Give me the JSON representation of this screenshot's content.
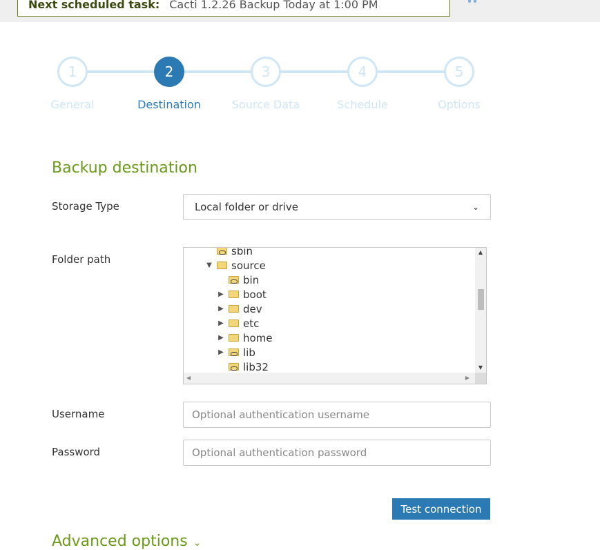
{
  "header": {
    "scheduled_label": "Next scheduled task:",
    "scheduled_value": "Cacti 1.2.26 Backup Today at 1:00 PM"
  },
  "steps": [
    {
      "num": "1",
      "label": "General"
    },
    {
      "num": "2",
      "label": "Destination"
    },
    {
      "num": "3",
      "label": "Source Data"
    },
    {
      "num": "4",
      "label": "Schedule"
    },
    {
      "num": "5",
      "label": "Options"
    }
  ],
  "active_step": 2,
  "section": {
    "title": "Backup destination"
  },
  "storage": {
    "label": "Storage Type",
    "value": "Local folder or drive"
  },
  "folder": {
    "label": "Folder path",
    "tree": [
      {
        "name": "sbin",
        "icon": "folder-link-icon",
        "toggle": "",
        "depth": 1
      },
      {
        "name": "source",
        "icon": "folder-icon",
        "toggle": "▼",
        "depth": 1
      },
      {
        "name": "bin",
        "icon": "folder-link-icon",
        "toggle": "",
        "depth": 2
      },
      {
        "name": "boot",
        "icon": "folder-icon",
        "toggle": "▶",
        "depth": 2
      },
      {
        "name": "dev",
        "icon": "folder-icon",
        "toggle": "▶",
        "depth": 2
      },
      {
        "name": "etc",
        "icon": "folder-icon",
        "toggle": "▶",
        "depth": 2
      },
      {
        "name": "home",
        "icon": "folder-icon",
        "toggle": "▶",
        "depth": 2
      },
      {
        "name": "lib",
        "icon": "folder-link-icon",
        "toggle": "▶",
        "depth": 2
      },
      {
        "name": "lib32",
        "icon": "folder-link-icon",
        "toggle": "",
        "depth": 2
      }
    ]
  },
  "username": {
    "label": "Username",
    "placeholder": "Optional authentication username"
  },
  "password": {
    "label": "Password",
    "placeholder": "Optional authentication password"
  },
  "test_button": "Test connection",
  "advanced": {
    "label": "Advanced options"
  },
  "colors": {
    "accent_blue": "#2c7ab4",
    "accent_green": "#6b9a1a",
    "step_inactive": "#cfe6f5"
  }
}
